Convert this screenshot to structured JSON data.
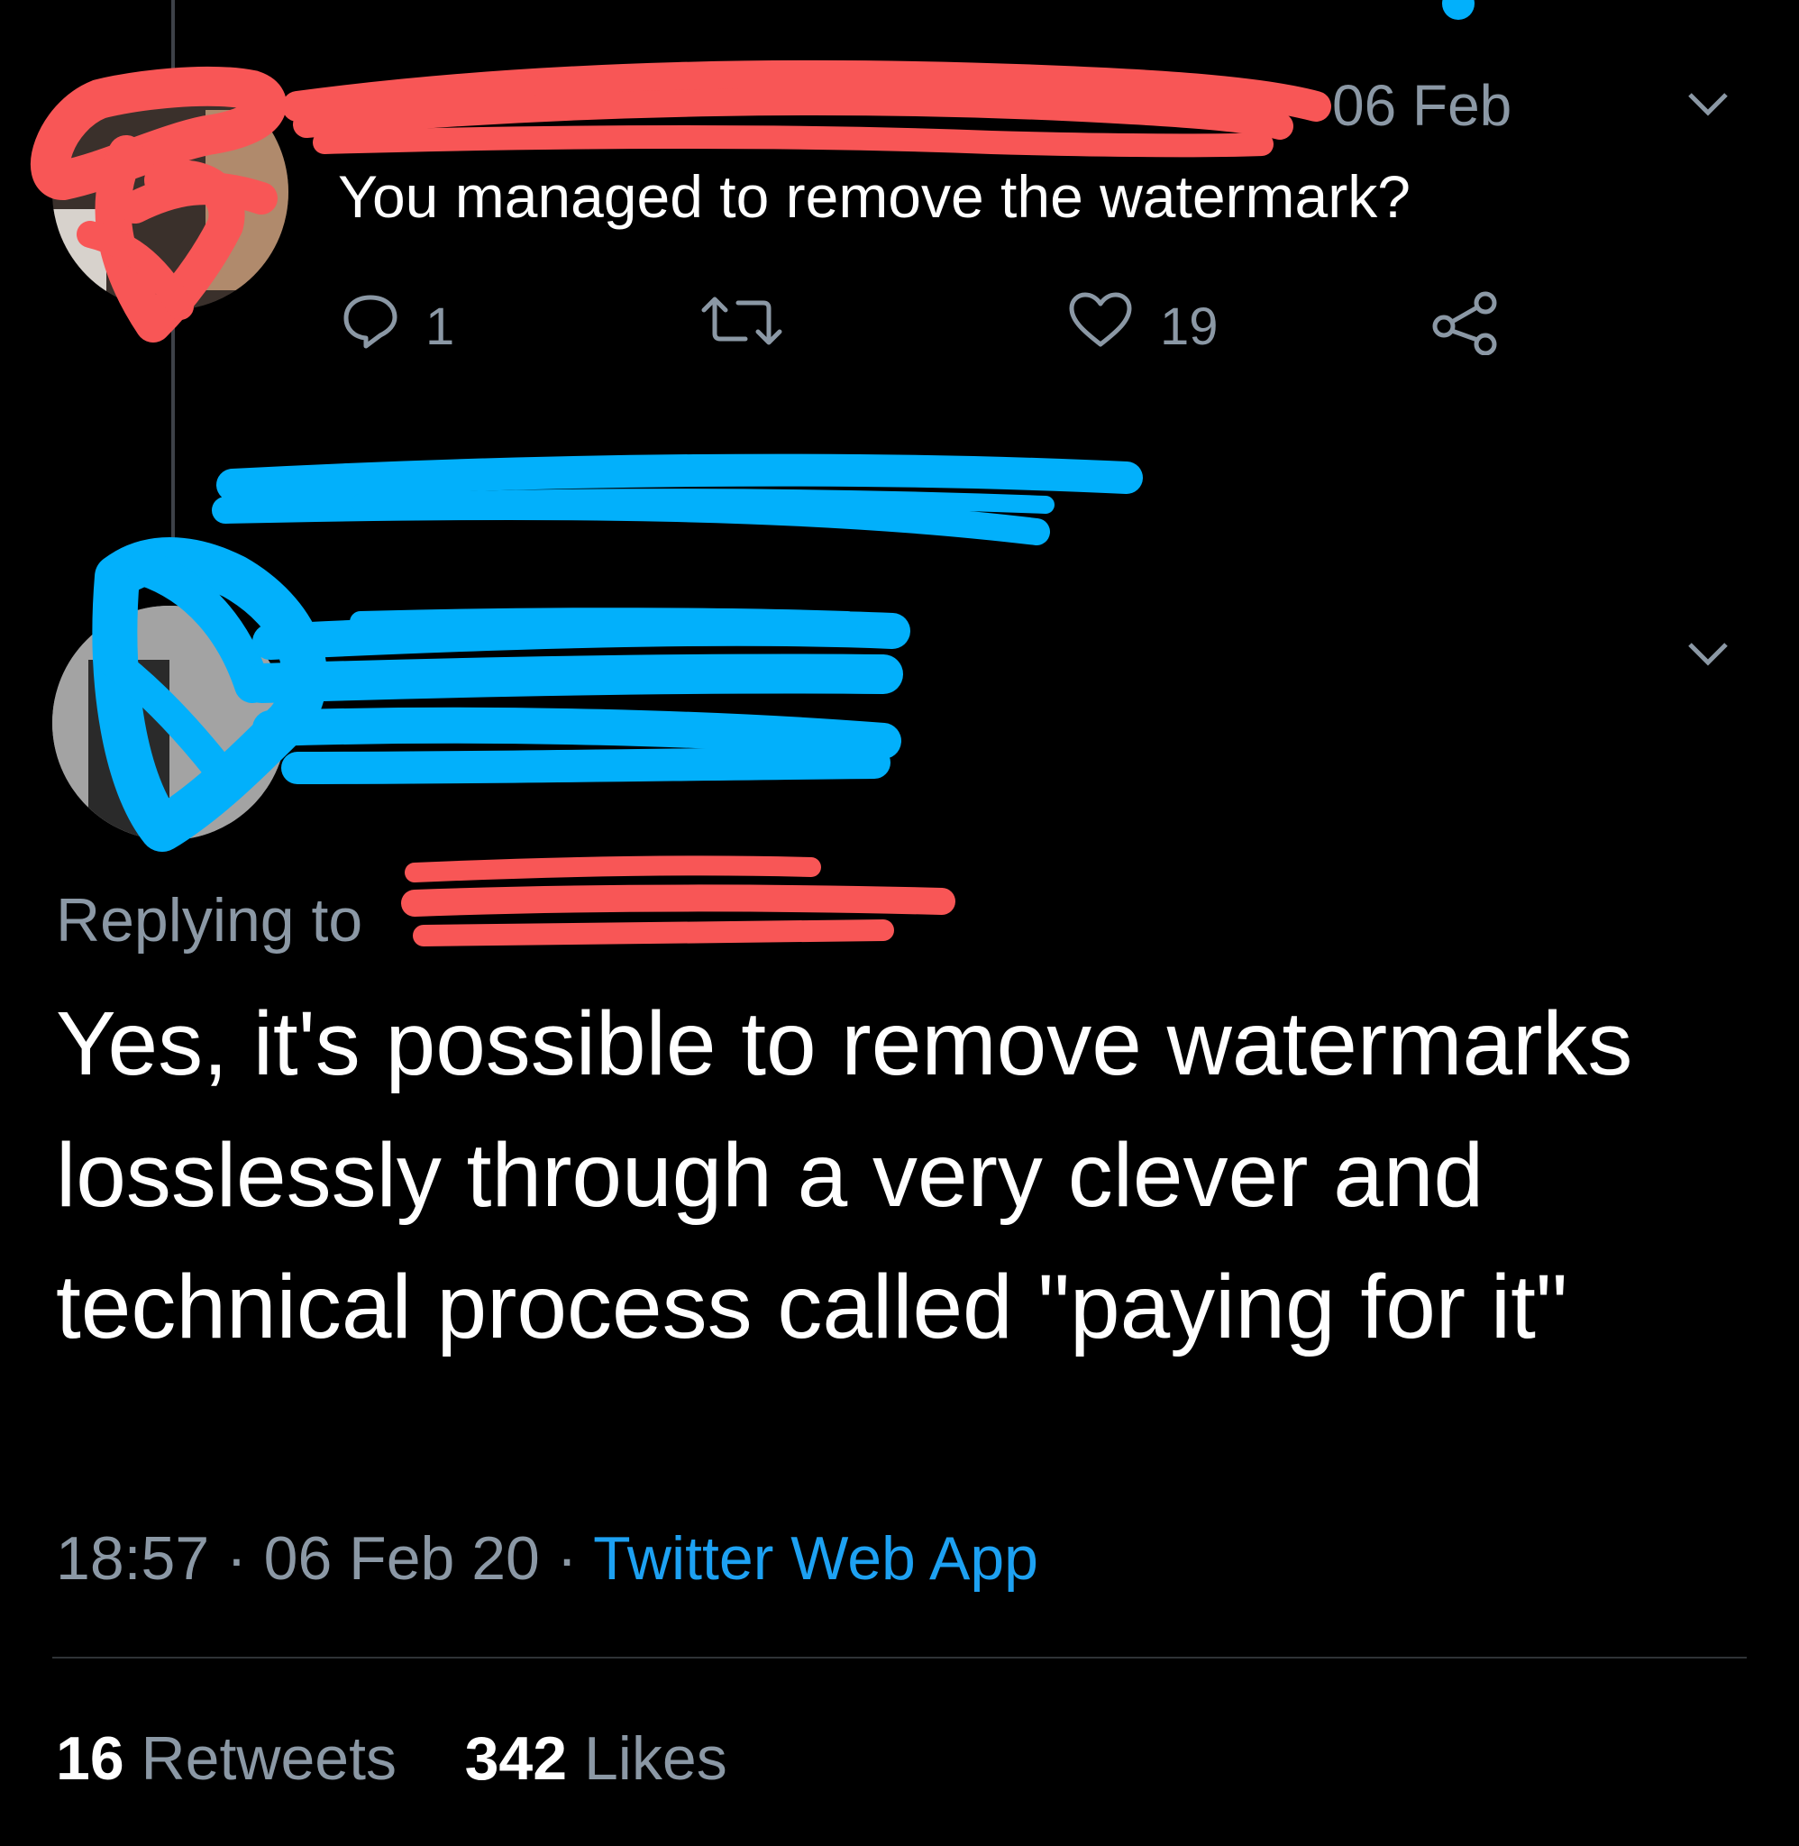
{
  "colors": {
    "background": "#000000",
    "secondary_text": "#8b98a5",
    "link": "#1da1f2",
    "redaction_red": "#f85656",
    "redaction_blue": "#02b0fb"
  },
  "parent_tweet": {
    "date": "06 Feb",
    "text": "You managed to remove the watermark?",
    "reply_count": "1",
    "like_count": "19",
    "icons": [
      "reply-icon",
      "retweet-icon",
      "like-icon",
      "share-icon",
      "chevron-down-icon"
    ]
  },
  "main_tweet": {
    "replying_to_label": "Replying to",
    "text": "Yes, it's possible to remove watermarks losslessly through a very clever and technical process called \"paying for it\"",
    "time": "18:57",
    "separator": "·",
    "date": "06 Feb 20",
    "source": "Twitter Web App",
    "retweets_count": "16",
    "retweets_label": "Retweets",
    "likes_count": "342",
    "likes_label": "Likes"
  }
}
